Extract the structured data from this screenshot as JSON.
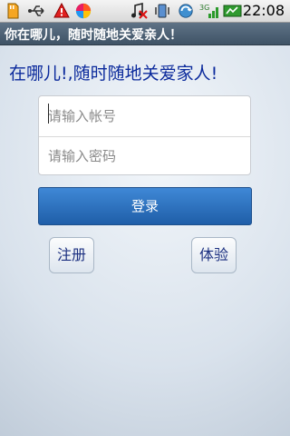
{
  "status_bar": {
    "time": "22:08",
    "icons": [
      "sd-card-icon",
      "usb-icon",
      "warning-icon",
      "app-colorful-icon",
      "music-muted-icon",
      "vibrate-icon",
      "sync-icon",
      "3g-signal-icon",
      "battery-icon"
    ]
  },
  "app": {
    "title": "你在哪儿，随时随地关爱亲人！"
  },
  "login": {
    "slogan": "在哪儿!,随时随地关爱家人!",
    "account_placeholder": "请输入帐号",
    "password_placeholder": "请输入密码",
    "login_label": "登录",
    "register_label": "注册",
    "trial_label": "体验"
  },
  "colors": {
    "accent": "#2b70c0",
    "slogan": "#0b2a9c",
    "titlebar": "#4a5e72"
  }
}
